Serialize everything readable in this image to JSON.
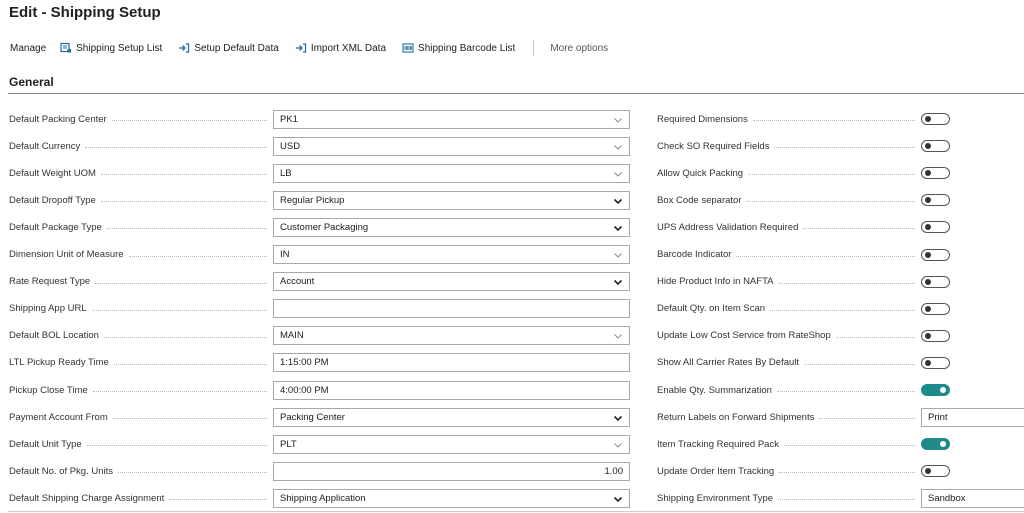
{
  "page": {
    "title": "Edit - Shipping Setup"
  },
  "actionbar": {
    "manage_label": "Manage",
    "actions": [
      {
        "label": "Shipping Setup List",
        "icon": "list-edit-icon"
      },
      {
        "label": "Setup Default Data",
        "icon": "arrow-into-icon"
      },
      {
        "label": "Import XML Data",
        "icon": "arrow-into-icon"
      },
      {
        "label": "Shipping Barcode List",
        "icon": "barcode-list-icon"
      }
    ],
    "more_label": "More options"
  },
  "section": {
    "title": "General"
  },
  "left_fields": [
    {
      "label": "Default Packing Center",
      "value": "PK1",
      "control": "lookup"
    },
    {
      "label": "Default Currency",
      "value": "USD",
      "control": "lookup"
    },
    {
      "label": "Default Weight UOM",
      "value": "LB",
      "control": "lookup"
    },
    {
      "label": "Default Dropoff Type",
      "value": "Regular Pickup",
      "control": "select"
    },
    {
      "label": "Default Package Type",
      "value": "Customer Packaging",
      "control": "select"
    },
    {
      "label": "Dimension Unit of Measure",
      "value": "IN",
      "control": "lookup"
    },
    {
      "label": "Rate Request Type",
      "value": "Account",
      "control": "select"
    },
    {
      "label": "Shipping App URL",
      "value": "",
      "control": "text"
    },
    {
      "label": "Default BOL Location",
      "value": "MAIN",
      "control": "lookup"
    },
    {
      "label": "LTL Pickup Ready Time",
      "value": "1:15:00 PM",
      "control": "text"
    },
    {
      "label": "Pickup Close Time",
      "value": "4:00:00 PM",
      "control": "text"
    },
    {
      "label": "Payment Account From",
      "value": "Packing Center",
      "control": "select"
    },
    {
      "label": "Default Unit Type",
      "value": "PLT",
      "control": "lookup"
    },
    {
      "label": "Default No. of Pkg. Units",
      "value": "1.00",
      "control": "number"
    },
    {
      "label": "Default Shipping Charge Assignment",
      "value": "Shipping Application",
      "control": "select"
    }
  ],
  "right_fields": [
    {
      "label": "Required Dimensions",
      "control": "toggle",
      "on": false
    },
    {
      "label": "Check SO Required Fields",
      "control": "toggle",
      "on": false
    },
    {
      "label": "Allow Quick Packing",
      "control": "toggle",
      "on": false
    },
    {
      "label": "Box Code separator",
      "control": "toggle",
      "on": false
    },
    {
      "label": "UPS Address Validation Required",
      "control": "toggle",
      "on": false
    },
    {
      "label": "Barcode Indicator",
      "control": "toggle",
      "on": false
    },
    {
      "label": "Hide Product Info in NAFTA",
      "control": "toggle",
      "on": false
    },
    {
      "label": "Default Qty. on Item Scan",
      "control": "toggle",
      "on": false
    },
    {
      "label": "Update Low Cost Service from RateShop",
      "control": "toggle",
      "on": false
    },
    {
      "label": "Show All Carrier Rates By Default",
      "control": "toggle",
      "on": false
    },
    {
      "label": "Enable Qty. Summarization",
      "control": "toggle",
      "on": true
    },
    {
      "label": "Return Labels on Forward Shipments",
      "control": "field",
      "value": "Print"
    },
    {
      "label": "Item Tracking Required Pack",
      "control": "toggle",
      "on": true
    },
    {
      "label": "Update Order Item Tracking",
      "control": "toggle",
      "on": false
    },
    {
      "label": "Shipping Environment Type",
      "control": "field",
      "value": "Sandbox"
    }
  ],
  "colors": {
    "toggle_on": "#1e8a8a",
    "accent_icon": "#1f6e9e"
  }
}
